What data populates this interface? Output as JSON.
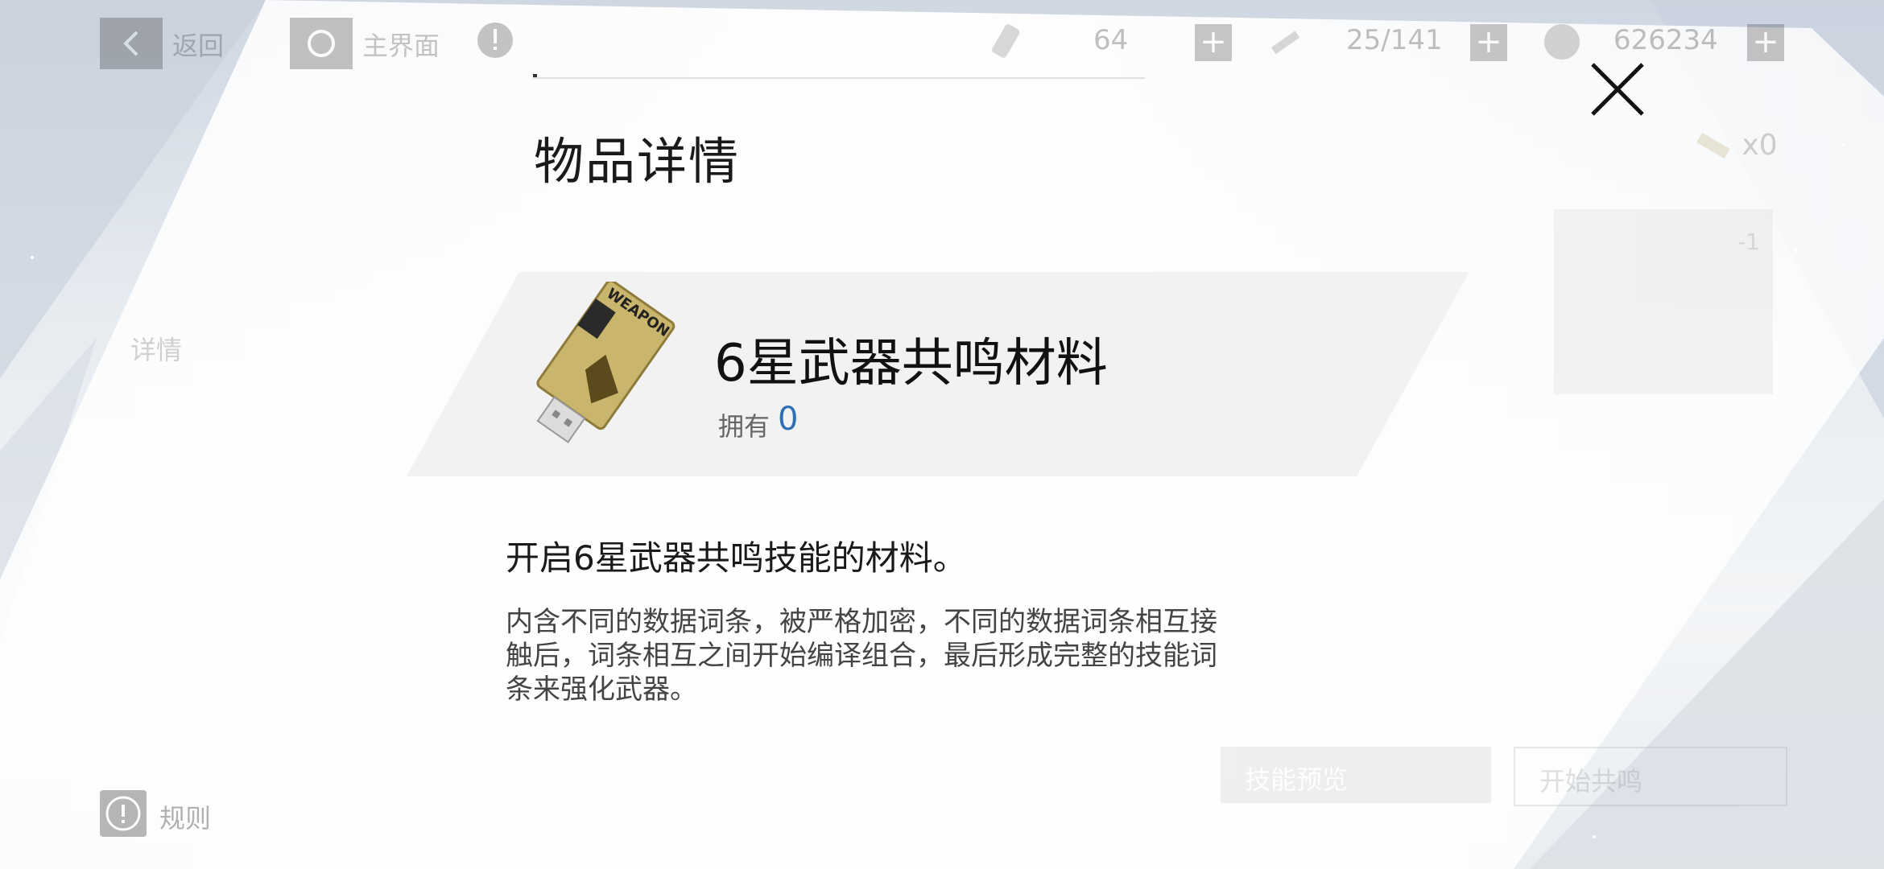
{
  "topbar": {
    "back_label": "返回",
    "home_label": "主界面",
    "resources": [
      {
        "name": "stamina-icon",
        "value": "64"
      },
      {
        "name": "key-icon",
        "value": "25/141"
      },
      {
        "name": "coin-icon",
        "value": "626234"
      }
    ],
    "plus": "+"
  },
  "dialog": {
    "title": "物品详情",
    "item": {
      "name": "6星武器共鸣材料",
      "own_label": "拥有",
      "own_count": "0",
      "usb_text": "WEAPON"
    },
    "description": "开启6星武器共鸣技能的材料。",
    "lore": "内含不同的数据词条，被严格加密，不同的数据词条相互接触后，词条相互之间开始编译组合，最后形成完整的技能词条来强化武器。"
  },
  "background": {
    "count_label": "x0",
    "side_text": "详情",
    "slot_value": "-1",
    "skill_preview_label": "技能预览",
    "start_resonance_label": "开始共鸣",
    "rules_label": "规则"
  },
  "colors": {
    "accent_blue": "#2f6fb4",
    "band": "#f2f2f2",
    "text": "#1a1a1a"
  }
}
